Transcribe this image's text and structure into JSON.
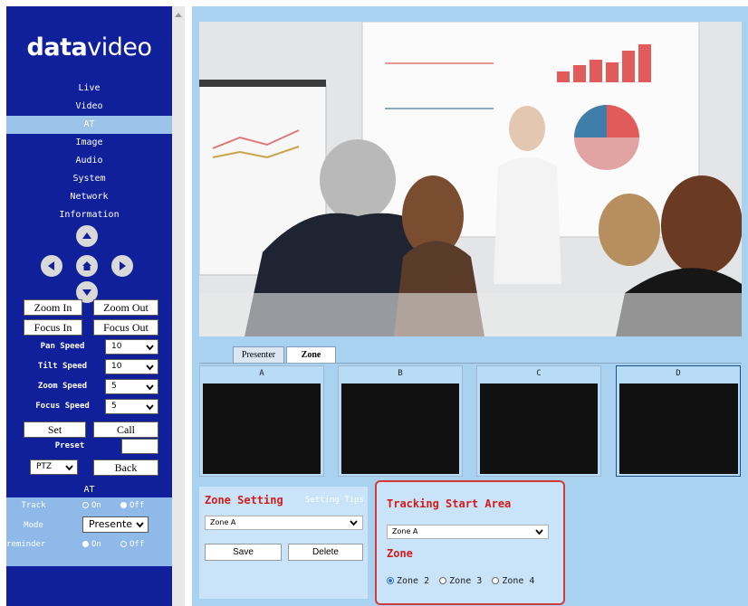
{
  "brand": {
    "logo_bold": "data",
    "logo_light": "video"
  },
  "nav": {
    "items": [
      {
        "label": "Live"
      },
      {
        "label": "Video"
      },
      {
        "label": "AT",
        "active": true
      },
      {
        "label": "Image"
      },
      {
        "label": "Audio"
      },
      {
        "label": "System"
      },
      {
        "label": "Network"
      },
      {
        "label": "Information"
      }
    ]
  },
  "dpad": {
    "icons": [
      "arrow-up-icon",
      "arrow-left-icon",
      "home-icon",
      "arrow-right-icon",
      "arrow-down-icon"
    ]
  },
  "controls": {
    "zoom_in": "Zoom In",
    "zoom_out": "Zoom Out",
    "focus_in": "Focus In",
    "focus_out": "Focus Out",
    "pan_speed_label": "Pan Speed",
    "pan_speed_value": "10",
    "tilt_speed_label": "Tilt Speed",
    "tilt_speed_value": "10",
    "zoom_speed_label": "Zoom Speed",
    "zoom_speed_value": "5",
    "focus_speed_label": "Focus Speed",
    "focus_speed_value": "5",
    "set": "Set",
    "call": "Call",
    "preset_label": "Preset",
    "preset_value": "",
    "mode_select": "PTZ",
    "back": "Back"
  },
  "at": {
    "header": "AT",
    "track_label": "Track",
    "track_on": "On",
    "track_off": "Off",
    "track_selected": "Off",
    "mode_label": "Mode",
    "mode_value": "Presente",
    "reminder_label": "reminder",
    "reminder_on": "On",
    "reminder_off": "Off",
    "reminder_selected": "On"
  },
  "main": {
    "tabs": [
      {
        "label": "Presenter",
        "active": false
      },
      {
        "label": "Zone",
        "active": true
      }
    ],
    "zones": [
      {
        "label": "A"
      },
      {
        "label": "B"
      },
      {
        "label": "C"
      },
      {
        "label": "D",
        "selected": true
      }
    ],
    "zone_setting": {
      "title": "Zone Setting",
      "tips": "Setting Tips",
      "select_value": "Zone A",
      "save": "Save",
      "delete": "Delete"
    },
    "tracking": {
      "title": "Tracking Start Area",
      "select_value": "Zone A",
      "zone_title": "Zone",
      "options": [
        {
          "label": "Zone 2",
          "selected": true
        },
        {
          "label": "Zone 3",
          "selected": false
        },
        {
          "label": "Zone 4",
          "selected": false
        }
      ]
    }
  },
  "colors": {
    "sidebar": "#10209a",
    "main_bg": "#a9d2f1",
    "accent_red": "#d41a1a",
    "highlight_border": "#d23a3a"
  }
}
